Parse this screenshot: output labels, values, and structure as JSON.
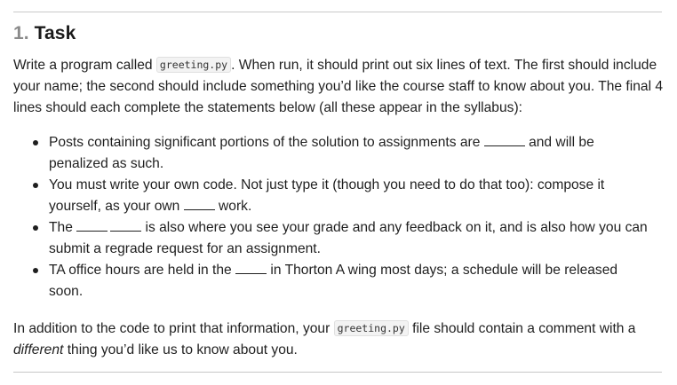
{
  "heading": {
    "number": "1.",
    "title": "Task"
  },
  "intro": {
    "t1": "Write a program called ",
    "code": "greeting.py",
    "t2": ". When run, it should print out six lines of text. The first should include your name; the second should include something you’d like the course staff to know about you. The final 4 lines should each complete the statements below (all these appear in the syllabus):"
  },
  "bullets": [
    {
      "before": "Posts containing significant portions of the solution to assignments are ",
      "after": " and will be penalized as such."
    },
    {
      "before": "You must write your own code. Not just type it (though you need to do that too): compose it yourself, as your own ",
      "after": " work."
    },
    {
      "before": "The ",
      "after": " is also where you see your grade and any feedback on it, and is also how you can submit a regrade request for an assignment."
    },
    {
      "before": "TA office hours are held in the ",
      "after": " in Thorton A wing most days; a schedule will be released soon."
    }
  ],
  "closing": {
    "t1": "In addition to the code to print that information, your ",
    "code": "greeting.py",
    "t2": " file should contain a comment with a ",
    "em": "different",
    "t3": " thing you’d like us to know about you."
  }
}
